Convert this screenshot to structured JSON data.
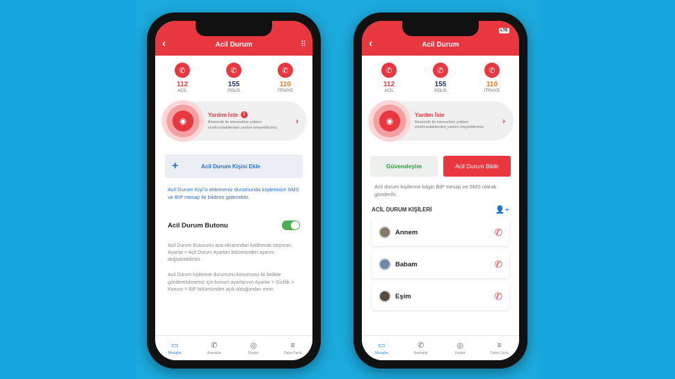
{
  "left_phone": {
    "topbar": {
      "title": "Acil Durum"
    },
    "emergency": [
      {
        "number": "112",
        "label": "ACİL",
        "color": "#e8373f"
      },
      {
        "number": "155",
        "label": "POLİS",
        "color": "#1d2e6b"
      },
      {
        "number": "110",
        "label": "İTFAİYE",
        "color": "#f07a18"
      }
    ],
    "help": {
      "title": "Yardım İste",
      "badge": "3",
      "desc": "Bluetooth ile internetiniz yokken etrafınızdakilerden yardım isteyebilirsiniz."
    },
    "add_contact": "Acil Durum Kişisi Ekle",
    "blue_note": "Acil Durum Kişi'si eklemeniz durumunda kişilerinize SMS ve BİP mesajı ile bildirim gidecektir.",
    "toggle_label": "Acil Durum Butonu",
    "gray_note_1": "Acil Durum Butonunu ana ekranından kaldırmak istiyoran, Ayarlar > Acil Durum Ayarları bölümünden ayarını değiştirebilirsin.",
    "gray_note_2": "Acil Durum kişilerine durumunu konumunu ile birlikte gönderebilmemiz için konum ayarlarının Ayarlar > Gizlilik > Konum > BiP bölümünden açık olduğundan emin",
    "tabs": [
      "Mesajlar",
      "Aramalar",
      "Keşfet",
      "Daha Fazla"
    ]
  },
  "right_phone": {
    "topbar": {
      "title": "Acil Durum",
      "status": "LTE"
    },
    "emergency": [
      {
        "number": "112",
        "label": "ACİL",
        "color": "#e8373f"
      },
      {
        "number": "155",
        "label": "POLİS",
        "color": "#1d2e6b"
      },
      {
        "number": "110",
        "label": "İTFAİYE",
        "color": "#f07a18"
      }
    ],
    "help": {
      "title": "Yardım İste",
      "desc": "Bluetooth ile internetiniz yokken etrafınızdakilerden yardım isteyebilirsiniz."
    },
    "safe_button": "Güvendeyim",
    "report_button": "Acil Durum Bildir",
    "info_note": "Acil durum kişilerine bilgin BİP mesajı ve SMS olarak gönderilir.",
    "contacts_title": "ACİL DURUM KİŞİLERİ",
    "contacts": [
      "Annem",
      "Babam",
      "Eşim"
    ],
    "tabs": [
      "Mesajlar",
      "Aramalar",
      "Keşfet",
      "Daha Fazla"
    ]
  },
  "colors": {
    "brand_red": "#e8373f",
    "blue": "#2a6fd6",
    "background": "#1aa9de"
  }
}
